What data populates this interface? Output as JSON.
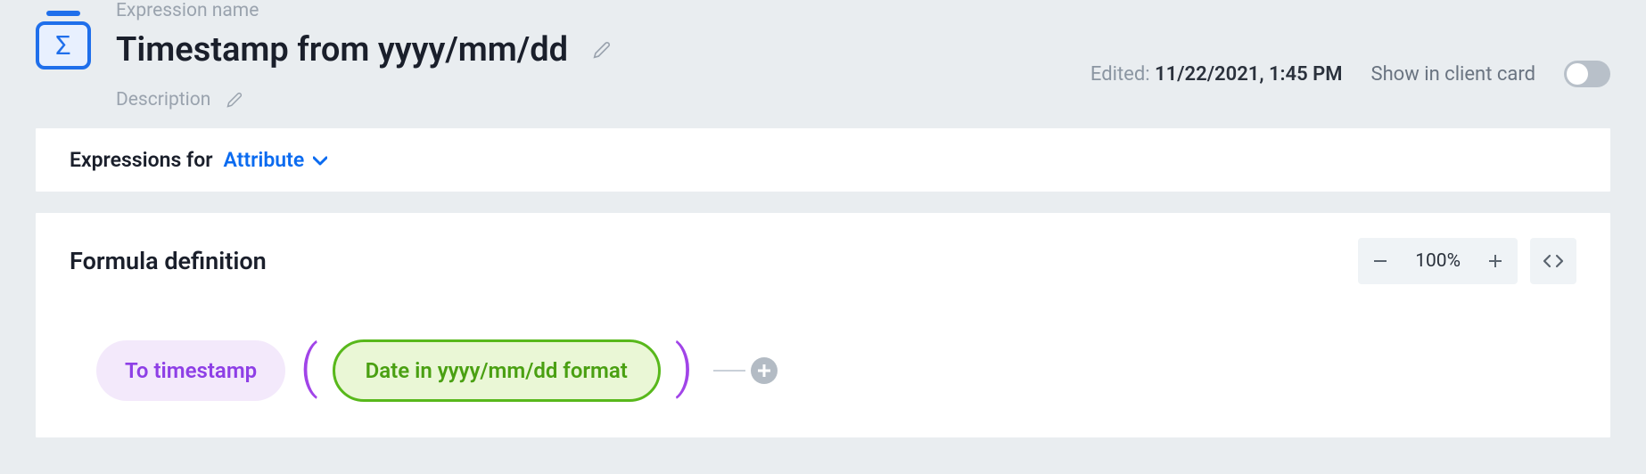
{
  "header": {
    "expression_name_label": "Expression name",
    "title": "Timestamp from yyyy/mm/dd",
    "description_label": "Description",
    "sigma_symbol": "Σ"
  },
  "meta": {
    "edited_label": "Edited: ",
    "edited_value": "11/22/2021, 1:45 PM",
    "show_label": "Show in client card",
    "toggle_on": false
  },
  "expressions_for": {
    "label": "Expressions for",
    "value": "Attribute"
  },
  "formula": {
    "section_title": "Formula definition",
    "zoom": "100%",
    "function_pill": "To timestamp",
    "argument_pill": "Date in yyyy/mm/dd format"
  }
}
